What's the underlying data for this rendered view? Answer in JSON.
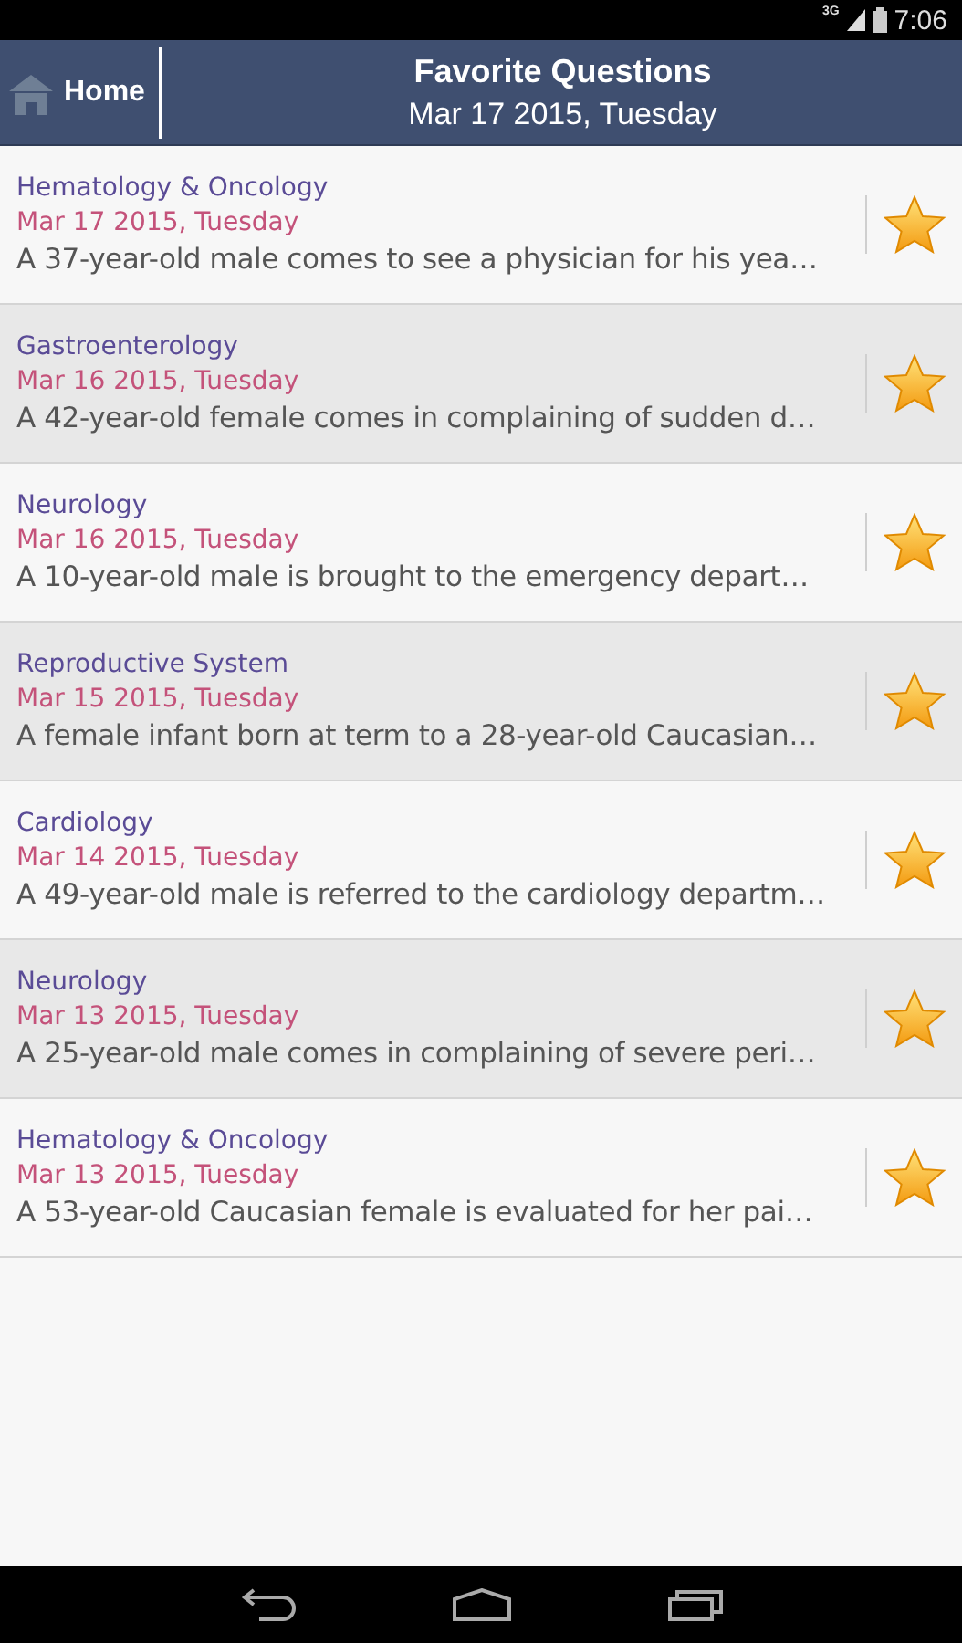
{
  "status_bar": {
    "network": "3G",
    "time": "7:06"
  },
  "header": {
    "home_label": "Home",
    "title": "Favorite Questions",
    "subtitle": "Mar 17 2015, Tuesday"
  },
  "questions": [
    {
      "category": "Hematology & Oncology",
      "date": "Mar 17 2015, Tuesday",
      "text": "A 37-year-old male comes to see a physician for his yea…",
      "starred": true
    },
    {
      "category": "Gastroenterology",
      "date": "Mar 16 2015, Tuesday",
      "text": "A 42-year-old female comes in complaining of sudden d…",
      "starred": true
    },
    {
      "category": "Neurology",
      "date": "Mar 16 2015, Tuesday",
      "text": "A 10-year-old male is brought to the emergency depart…",
      "starred": true
    },
    {
      "category": "Reproductive System",
      "date": "Mar 15 2015, Tuesday",
      "text": "A female infant born at term to a 28-year-old Caucasian…",
      "starred": true
    },
    {
      "category": "Cardiology",
      "date": "Mar 14 2015, Tuesday",
      "text": "A 49-year-old male is referred to the cardiology departm…",
      "starred": true
    },
    {
      "category": "Neurology",
      "date": "Mar 13 2015, Tuesday",
      "text": "A 25-year-old male comes in complaining of severe peri…",
      "starred": true
    },
    {
      "category": "Hematology & Oncology",
      "date": "Mar 13 2015, Tuesday",
      "text": "A 53-year-old Caucasian female is evaluated for her pai…",
      "starred": true
    }
  ]
}
